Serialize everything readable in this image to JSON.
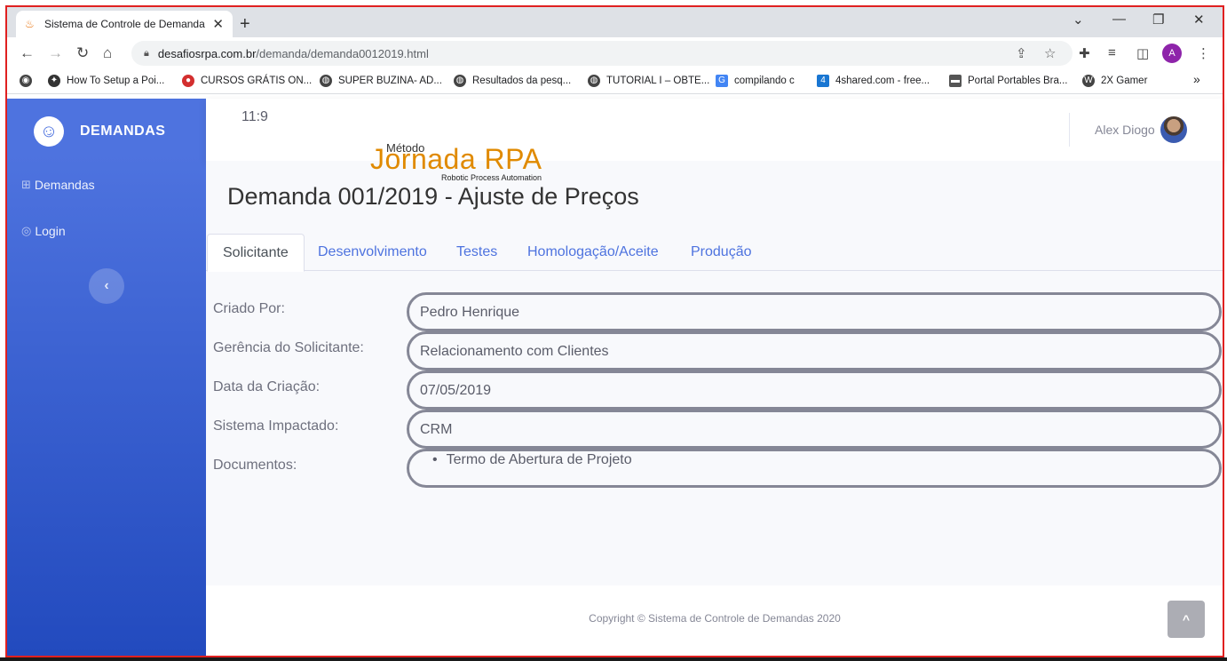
{
  "browser": {
    "tab_title": "Sistema de Controle de Demanda",
    "tab_close": "✕",
    "new_tab": "+",
    "url_domain": "desafiosrpa.com.br",
    "url_path": "/demanda/demanda0012019.html",
    "profile_initial": "A",
    "bookmarks": [
      {
        "label": "How To Setup a Poi...",
        "icon": "bookmark-site-icon",
        "color": "#333333"
      },
      {
        "label": "CURSOS GRÁTIS ON...",
        "icon": "bookmark-site-icon",
        "color": "#d32f2f"
      },
      {
        "label": "SUPER BUZINA- AD...",
        "icon": "globe-icon",
        "color": "#444444"
      },
      {
        "label": "Resultados da pesq...",
        "icon": "globe-icon",
        "color": "#444444"
      },
      {
        "label": "TUTORIAL I – OBTE...",
        "icon": "globe-icon",
        "color": "#444444"
      },
      {
        "label": "compilando c",
        "icon": "translate-icon",
        "color": "#4285f4"
      },
      {
        "label": "4shared.com - free...",
        "icon": "4shared-icon",
        "color": "#1976d2"
      },
      {
        "label": "Portal Portables Bra...",
        "icon": "bookmark-site-icon",
        "color": "#555555"
      },
      {
        "label": "2X Gamer",
        "icon": "wordpress-icon",
        "color": "#444444"
      }
    ],
    "more_bookmarks": "»"
  },
  "sidebar": {
    "brand": "DEMANDAS",
    "items": [
      {
        "label": "Demandas",
        "icon": "table-icon"
      },
      {
        "label": "Login",
        "icon": "user-circle-icon"
      }
    ],
    "toggle_icon": "‹"
  },
  "topbar": {
    "clock": "11:9",
    "user_name": "Alex Diogo"
  },
  "logo": {
    "top": "Método",
    "main": "Jornada RPA",
    "sub": "Robotic Process Automation"
  },
  "page": {
    "title": "Demanda 001/2019 - Ajuste de Preços",
    "tabs": [
      "Solicitante",
      "Desenvolvimento",
      "Testes",
      "Homologação/Aceite",
      "Produção"
    ],
    "active_tab": "Solicitante",
    "fields": [
      {
        "label": "Criado Por:",
        "value": "Pedro Henrique"
      },
      {
        "label": "Gerência do Solicitante:",
        "value": "Relacionamento com Clientes"
      },
      {
        "label": "Data da Criação:",
        "value": "07/05/2019"
      },
      {
        "label": "Sistema Impactado:",
        "value": "CRM"
      },
      {
        "label": "Documentos:",
        "value": "Termo de Abertura de Projeto"
      }
    ]
  },
  "footer": {
    "copyright": "Copyright © Sistema de Controle de Demandas 2020",
    "scroll_icon": "^"
  },
  "colors": {
    "primary": "#4e73df",
    "sidebar_end": "#224abe",
    "logo_orange": "#e08a00",
    "frame_red": "#e02020"
  }
}
